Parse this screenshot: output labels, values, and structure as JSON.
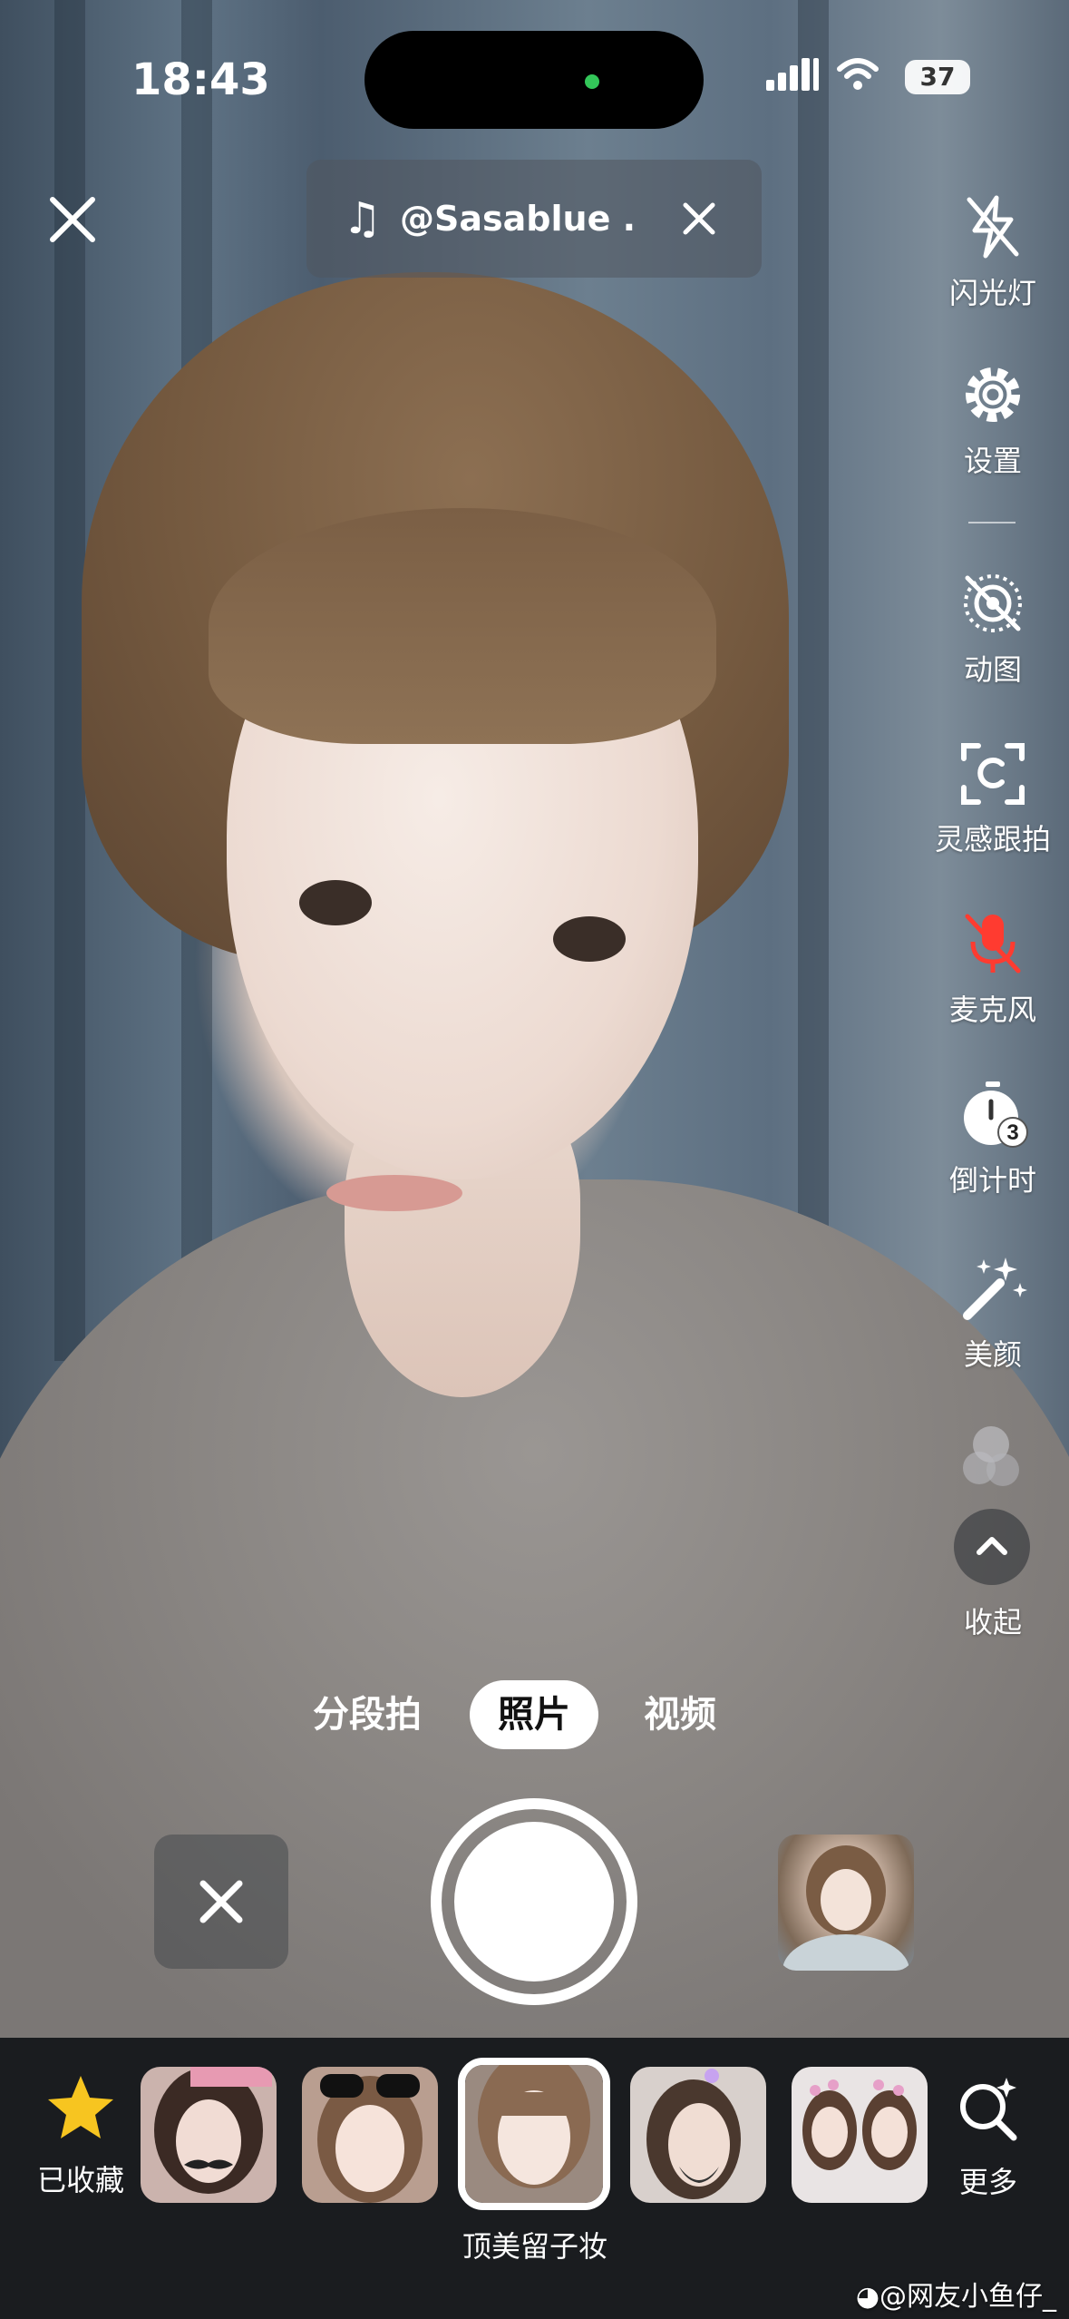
{
  "status_bar": {
    "time": "18:43",
    "battery": "37"
  },
  "music": {
    "title": "@Sasablue ...",
    "note_icon": "music-note-icon",
    "close_icon": "close-icon"
  },
  "tools": [
    {
      "id": "flash",
      "label": "闪光灯",
      "icon": "flash-off-icon"
    },
    {
      "id": "settings",
      "label": "设置",
      "icon": "gear-icon"
    },
    {
      "id": "gif",
      "label": "动图",
      "icon": "live-photo-off-icon"
    },
    {
      "id": "inspiration",
      "label": "灵感跟拍",
      "icon": "scan-frame-icon"
    },
    {
      "id": "mic",
      "label": "麦克风",
      "icon": "mic-off-icon"
    },
    {
      "id": "timer",
      "label": "倒计时",
      "icon": "timer-icon"
    },
    {
      "id": "beauty",
      "label": "美颜",
      "icon": "magic-wand-icon"
    },
    {
      "id": "collapse",
      "label": "收起",
      "icon": "chevron-up-icon"
    }
  ],
  "timer_badge": "3",
  "modes": [
    {
      "label": "分段拍",
      "active": false
    },
    {
      "label": "照片",
      "active": true
    },
    {
      "label": "视频",
      "active": false
    }
  ],
  "effects": {
    "favorites_label": "已收藏",
    "selected_label": "顶美留子妆",
    "more_label": "更多"
  },
  "watermark": "@网友小鱼仔_",
  "colors": {
    "mic_off": "#ff3b30",
    "favorite_star": "#f7c520",
    "wifi_signal": "#ffffff"
  }
}
